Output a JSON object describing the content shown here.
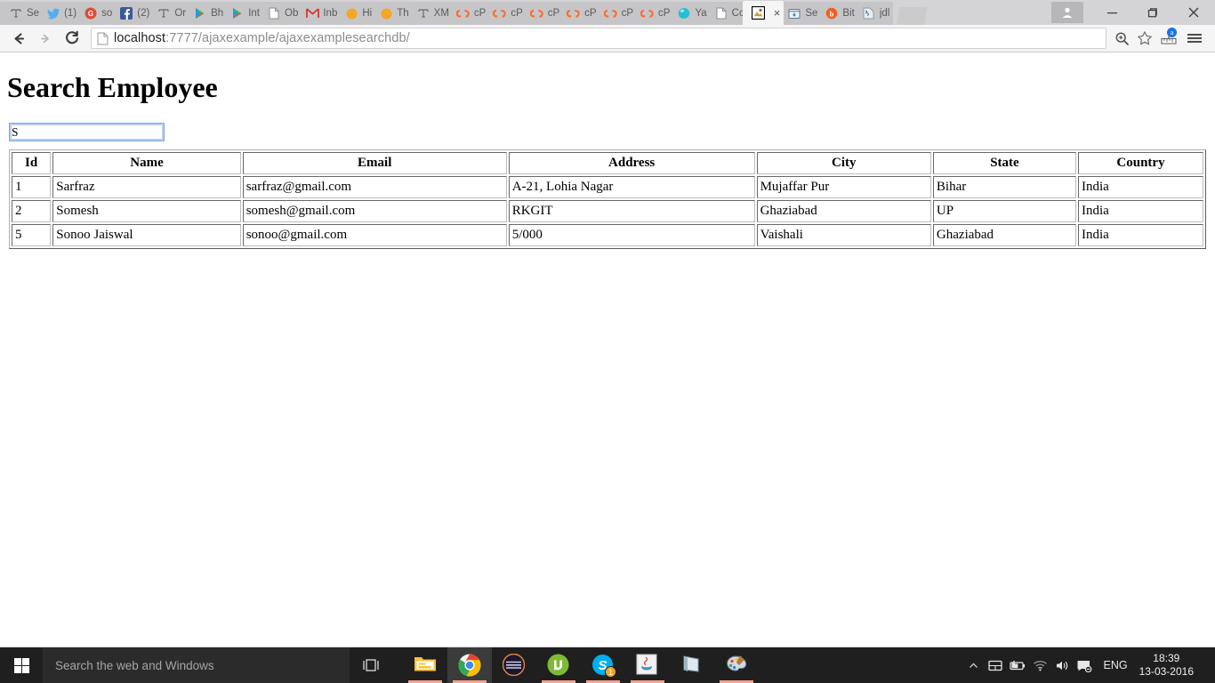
{
  "browser": {
    "tabs": [
      {
        "icon": "text-T-icon",
        "label": "Se"
      },
      {
        "icon": "twitter-icon",
        "label": "(1)"
      },
      {
        "icon": "google-plus-icon",
        "label": "so"
      },
      {
        "icon": "facebook-icon",
        "label": "(2)"
      },
      {
        "icon": "text-T-icon",
        "label": "Or"
      },
      {
        "icon": "play-store-icon",
        "label": "Bh"
      },
      {
        "icon": "play-store-icon",
        "label": "Int"
      },
      {
        "icon": "document-icon",
        "label": "Ob"
      },
      {
        "icon": "gmail-icon",
        "label": "Inb"
      },
      {
        "icon": "orange-dot-icon",
        "label": "Hi"
      },
      {
        "icon": "orange-dot-icon",
        "label": "Th"
      },
      {
        "icon": "text-T-icon",
        "label": "XM"
      },
      {
        "icon": "cpanel-icon",
        "label": "cP"
      },
      {
        "icon": "cpanel-icon",
        "label": "cP"
      },
      {
        "icon": "cpanel-icon",
        "label": "cP"
      },
      {
        "icon": "cpanel-icon",
        "label": "cP"
      },
      {
        "icon": "cpanel-icon",
        "label": "cP"
      },
      {
        "icon": "cpanel-icon",
        "label": "cP"
      },
      {
        "icon": "yahoo-icon",
        "label": "Ya"
      },
      {
        "icon": "document-icon",
        "label": "Cc"
      },
      {
        "icon": "broken-image-icon",
        "label": "",
        "active": true
      },
      {
        "icon": "store-icon",
        "label": "Se"
      },
      {
        "icon": "bitly-icon",
        "label": "Bit"
      },
      {
        "icon": "java-doc-icon",
        "label": "jdl"
      }
    ],
    "new_tab_label": "",
    "close_tab_label": "×",
    "window_controls": {
      "minimize": "—",
      "maximize": "❐",
      "close": "✕"
    },
    "toolbar": {
      "back_label": "←",
      "forward_label": "→",
      "reload_label": "C",
      "url_host": "localhost",
      "url_path": ":7777/ajaxexample/ajaxexamplesearchdb/",
      "zoom_icon": "zoom-in-icon",
      "bookmark_icon": "star-icon",
      "extension_icon": "ruler-extension-icon",
      "extension_badge": "a",
      "menu_icon": "hamburger-menu-icon"
    }
  },
  "page": {
    "heading": "Search Employee",
    "search": {
      "value": "S",
      "placeholder": ""
    },
    "table": {
      "columns": [
        "Id",
        "Name",
        "Email",
        "Address",
        "City",
        "State",
        "Country"
      ],
      "rows": [
        [
          "1",
          "Sarfraz",
          "sarfraz@gmail.com",
          "A-21, Lohia Nagar",
          "Mujaffar Pur",
          "Bihar",
          "India"
        ],
        [
          "2",
          "Somesh",
          "somesh@gmail.com",
          "RKGIT",
          "Ghaziabad",
          "UP",
          "India"
        ],
        [
          "5",
          "Sonoo Jaiswal",
          "sonoo@gmail.com",
          "5/000",
          "Vaishali",
          "Ghaziabad",
          "India"
        ]
      ]
    }
  },
  "taskbar": {
    "start_icon": "windows-logo-icon",
    "search_placeholder": "Search the web and Windows",
    "task_view_icon": "task-view-icon",
    "apps": [
      {
        "name": "file-explorer",
        "running": true,
        "active": false,
        "badge": ""
      },
      {
        "name": "google-chrome",
        "running": true,
        "active": true,
        "badge": ""
      },
      {
        "name": "dark-circle-app",
        "running": false,
        "active": false,
        "badge": ""
      },
      {
        "name": "utorrent",
        "running": true,
        "active": false,
        "badge": ""
      },
      {
        "name": "skype",
        "running": true,
        "active": false,
        "badge": "1"
      },
      {
        "name": "java",
        "running": true,
        "active": false,
        "badge": ""
      },
      {
        "name": "notepad",
        "running": false,
        "active": false,
        "badge": ""
      },
      {
        "name": "paint",
        "running": true,
        "active": false,
        "badge": ""
      }
    ],
    "tray": {
      "chevron_icon": "chevron-up-icon",
      "touchpad_icon": "touchpad-icon",
      "battery_icon": "battery-charging-icon",
      "wifi_icon": "wifi-icon",
      "volume_icon": "speaker-icon",
      "action_center_icon": "action-center-icon",
      "language": "ENG",
      "time": "18:39",
      "date": "13-03-2016"
    }
  }
}
